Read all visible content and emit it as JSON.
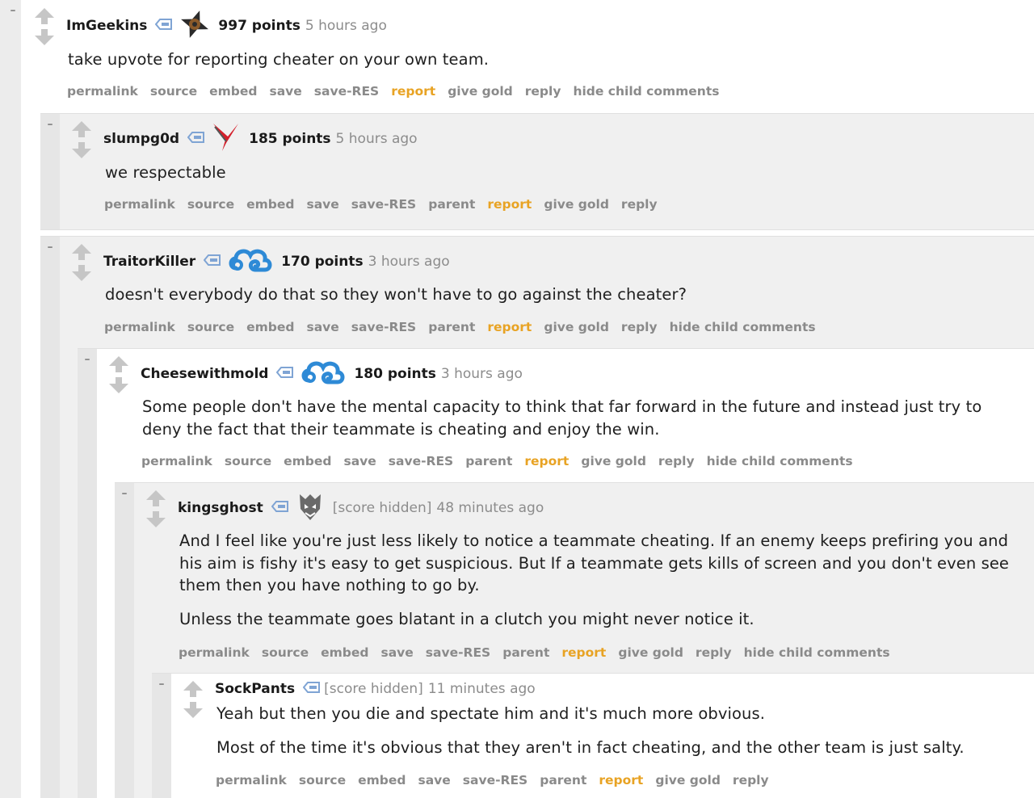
{
  "colors": {
    "background": "#f4f4f4",
    "panel_white": "#ffffff",
    "panel_gray": "#f0f0f0",
    "stripe": "#e6e6e6",
    "report_link": "#e8a324",
    "muted": "#8a8a8a"
  },
  "comments": [
    {
      "author": "ImGeekins",
      "flair_icon": "ninjas-in-pyjamas-flair-icon",
      "score": "997 points",
      "time": "5 hours ago",
      "body": [
        "take upvote for reporting cheater on your own team."
      ],
      "buttons": [
        "permalink",
        "source",
        "embed",
        "save",
        "save-RES",
        "report",
        "give gold",
        "reply",
        "hide child comments"
      ]
    },
    {
      "author": "slumpg0d",
      "flair_icon": "virtus-pro-flair-icon",
      "score": "185 points",
      "time": "5 hours ago",
      "body": [
        "we respectable"
      ],
      "buttons": [
        "permalink",
        "source",
        "embed",
        "save",
        "save-RES",
        "parent",
        "report",
        "give gold",
        "reply"
      ]
    },
    {
      "author": "TraitorKiller",
      "flair_icon": "cloud9-flair-icon",
      "score": "170 points",
      "time": "3 hours ago",
      "body": [
        "doesn't everybody do that so they won't have to go against the cheater?"
      ],
      "buttons": [
        "permalink",
        "source",
        "embed",
        "save",
        "save-RES",
        "parent",
        "report",
        "give gold",
        "reply",
        "hide child comments"
      ]
    },
    {
      "author": "Cheesewithmold",
      "flair_icon": "cloud9-flair-icon",
      "score": "180 points",
      "time": "3 hours ago",
      "body": [
        "Some people don't have the mental capacity to think that far forward in the future and instead just try to deny the fact that their teammate is cheating and enjoy the win."
      ],
      "buttons": [
        "permalink",
        "source",
        "embed",
        "save",
        "save-RES",
        "parent",
        "report",
        "give gold",
        "reply",
        "hide child comments"
      ]
    },
    {
      "author": "kingsghost",
      "flair_icon": "g2-esports-flair-icon",
      "score": "[score hidden]",
      "time": "48 minutes ago",
      "body": [
        "And I feel like you're just less likely to notice a teammate cheating. If an enemy keeps prefiring you and his aim is fishy it's easy to get suspicious. But If a teammate gets kills of screen and you don't even see them then you have nothing to go by.",
        "Unless the teammate goes blatant in a clutch you might never notice it."
      ],
      "buttons": [
        "permalink",
        "source",
        "embed",
        "save",
        "save-RES",
        "parent",
        "report",
        "give gold",
        "reply",
        "hide child comments"
      ]
    },
    {
      "author": "SockPants",
      "flair_icon": "",
      "score": "[score hidden]",
      "time": "11 minutes ago",
      "body": [
        "Yeah but then you die and spectate him and it's much more obvious.",
        "Most of the time it's obvious that they aren't in fact cheating, and the other team is just salty."
      ],
      "buttons": [
        "permalink",
        "source",
        "embed",
        "save",
        "save-RES",
        "parent",
        "report",
        "give gold",
        "reply"
      ]
    }
  ],
  "collapse_label": "–"
}
